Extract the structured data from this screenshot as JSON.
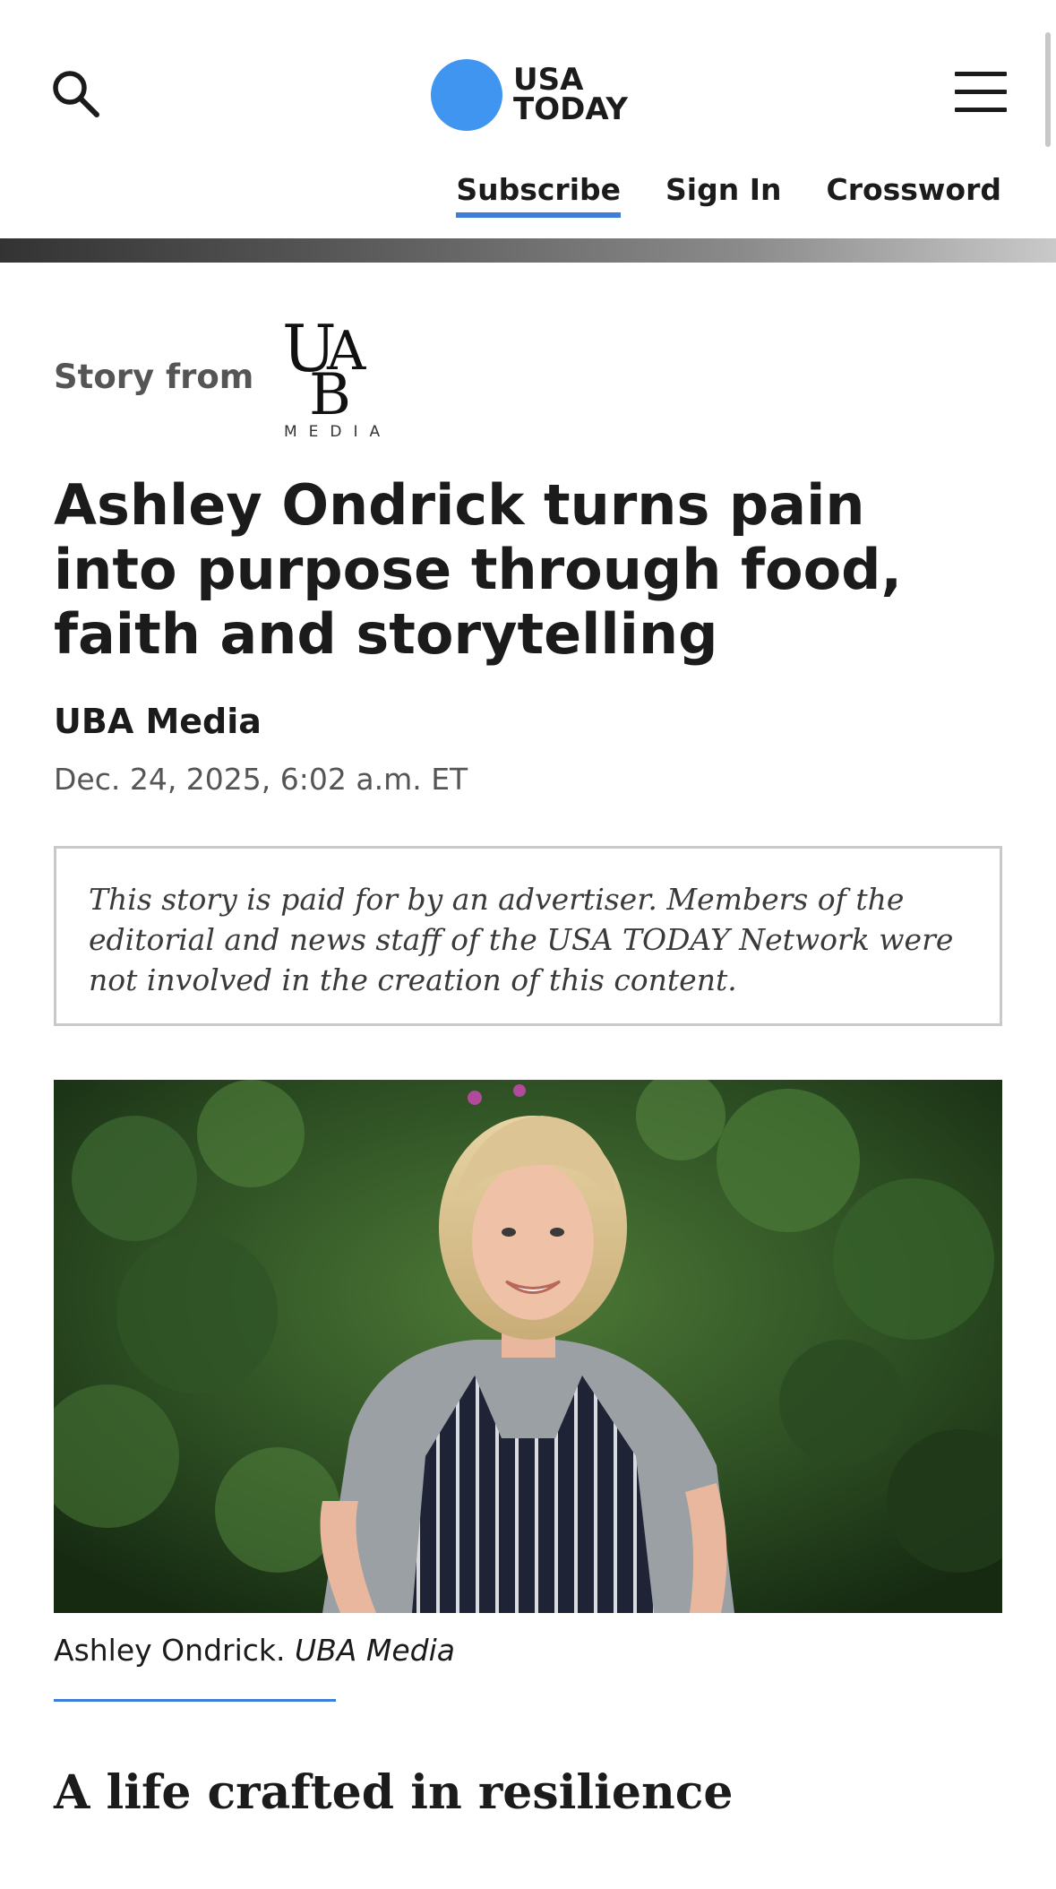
{
  "header": {
    "logo_line1": "USA",
    "logo_line2": "TODAY",
    "links": {
      "subscribe": "Subscribe",
      "sign_in": "Sign In",
      "crossword": "Crossword"
    },
    "brand_color": "#3f95f0"
  },
  "sponsor": {
    "label": "Story from",
    "logo_sub": "MEDIA"
  },
  "article": {
    "headline": "Ashley Ondrick turns pain into purpose through food, faith and storytelling",
    "byline": "UBA Media",
    "date": "Dec. 24, 2025, 6:02 a.m. ET",
    "disclaimer": "This story is paid for by an advertiser. Members of the editorial and news staff of the USA TODAY Network were not involved in the creation of this content.",
    "caption_name": "Ashley Ondrick.",
    "caption_credit": "UBA Media",
    "section_heading": "A life crafted in resilience"
  },
  "icons": {
    "search": "search-icon",
    "menu": "hamburger-menu-icon"
  }
}
